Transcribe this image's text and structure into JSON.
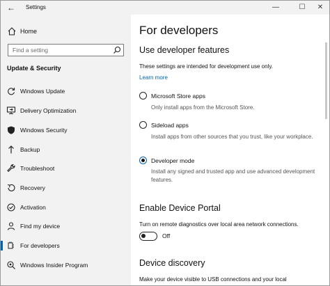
{
  "window": {
    "title": "Settings",
    "back_glyph": "←",
    "controls": {
      "minimize": "—",
      "maximize": "☐",
      "close": "✕"
    }
  },
  "sidebar": {
    "home_label": "Home",
    "search_placeholder": "Find a setting",
    "section_title": "Update & Security",
    "items": [
      {
        "label": "Windows Update",
        "icon": "refresh-icon"
      },
      {
        "label": "Delivery Optimization",
        "icon": "delivery-optimization-icon"
      },
      {
        "label": "Windows Security",
        "icon": "shield-icon"
      },
      {
        "label": "Backup",
        "icon": "backup-arrow-icon"
      },
      {
        "label": "Troubleshoot",
        "icon": "wrench-icon"
      },
      {
        "label": "Recovery",
        "icon": "recovery-icon"
      },
      {
        "label": "Activation",
        "icon": "activation-icon"
      },
      {
        "label": "Find my device",
        "icon": "person-icon"
      },
      {
        "label": "For developers",
        "icon": "developer-tools-icon",
        "selected": true
      },
      {
        "label": "Windows Insider Program",
        "icon": "insider-icon"
      }
    ]
  },
  "main": {
    "page_title": "For developers",
    "use_features": {
      "heading": "Use developer features",
      "description": "These settings are intended for development use only.",
      "learn_more": "Learn more",
      "options": [
        {
          "label": "Microsoft Store apps",
          "description": "Only install apps from the Microsoft Store.",
          "checked": false
        },
        {
          "label": "Sideload apps",
          "description": "Install apps from other sources that you trust, like your workplace.",
          "checked": false
        },
        {
          "label": "Developer mode",
          "description": "Install any signed and trusted app and use advanced development features.",
          "checked": true
        }
      ]
    },
    "device_portal": {
      "heading": "Enable Device Portal",
      "description": "Turn on remote diagnostics over local area network connections.",
      "toggle_state": "Off"
    },
    "device_discovery": {
      "heading": "Device discovery",
      "description": "Make your device visible to USB connections and your local"
    }
  }
}
